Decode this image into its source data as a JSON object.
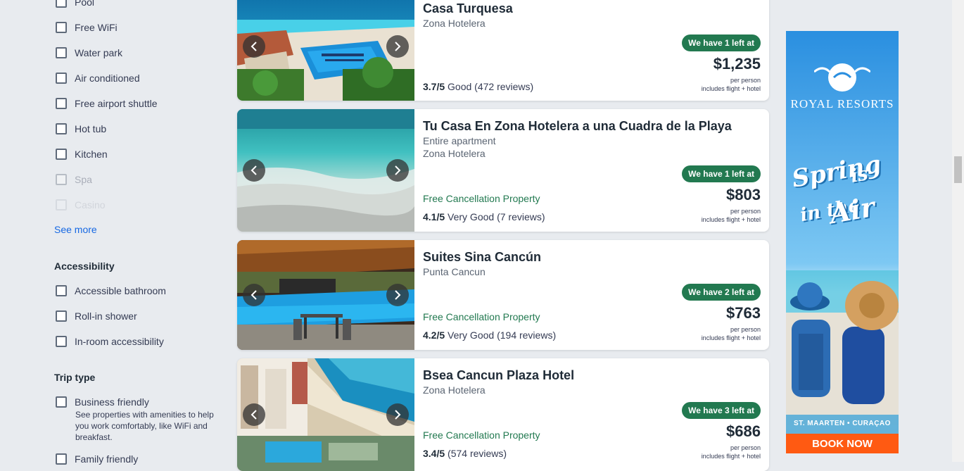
{
  "filters": {
    "amenities": [
      {
        "label": "Pool"
      },
      {
        "label": "Free WiFi"
      },
      {
        "label": "Water park"
      },
      {
        "label": "Air conditioned"
      },
      {
        "label": "Free airport shuttle"
      },
      {
        "label": "Hot tub"
      },
      {
        "label": "Kitchen"
      },
      {
        "label": "Spa"
      },
      {
        "label": "Casino"
      }
    ],
    "see_more": "See more",
    "accessibility": {
      "title": "Accessibility",
      "items": [
        {
          "label": "Accessible bathroom"
        },
        {
          "label": "Roll-in shower"
        },
        {
          "label": "In-room accessibility"
        }
      ]
    },
    "trip_type": {
      "title": "Trip type",
      "items": [
        {
          "label": "Business friendly",
          "description": "See properties with amenities to help you work comfortably, like WiFi and breakfast."
        },
        {
          "label": "Family friendly"
        }
      ]
    }
  },
  "listings": [
    {
      "name": "Casa Turquesa",
      "subtitle": "",
      "location": "Zona Hotelera",
      "free_cancellation": "",
      "rating": "3.7/5",
      "rating_text": "Good",
      "reviews": "(472 reviews)",
      "badge": "We have 1 left at",
      "price": "$1,235",
      "per_person": "per person",
      "includes": "includes flight + hotel"
    },
    {
      "name": "Tu Casa En Zona Hotelera a una Cuadra de la Playa",
      "subtitle": "Entire apartment",
      "location": "Zona Hotelera",
      "free_cancellation": "Free Cancellation Property",
      "rating": "4.1/5",
      "rating_text": "Very Good",
      "reviews": "(7 reviews)",
      "badge": "We have 1 left at",
      "price": "$803",
      "per_person": "per person",
      "includes": "includes flight + hotel"
    },
    {
      "name": "Suites Sina Cancún",
      "subtitle": "",
      "location": "Punta Cancun",
      "free_cancellation": "Free Cancellation Property",
      "rating": "4.2/5",
      "rating_text": "Very Good",
      "reviews": "(194 reviews)",
      "badge": "We have 2 left at",
      "price": "$763",
      "per_person": "per person",
      "includes": "includes flight + hotel"
    },
    {
      "name": "Bsea Cancun Plaza Hotel",
      "subtitle": "",
      "location": "Zona Hotelera",
      "free_cancellation": "Free Cancellation Property",
      "rating": "3.4/5",
      "rating_text": "",
      "reviews": "(574 reviews)",
      "badge": "We have 3 left at",
      "price": "$686",
      "per_person": "per person",
      "includes": "includes flight + hotel"
    }
  ],
  "ad": {
    "brand": "ROYAL RESORTS",
    "tagline_1": "Spring",
    "tagline_2": "is",
    "tagline_3": "in the",
    "tagline_4": "Air",
    "destinations": "ST. MAARTEN • CURAÇAO",
    "cta": "BOOK NOW"
  },
  "colors": {
    "accent_link": "#1668e3",
    "free_cancellation": "#227950",
    "badge_bg": "#227950",
    "ad_cta": "#ff5a12"
  }
}
